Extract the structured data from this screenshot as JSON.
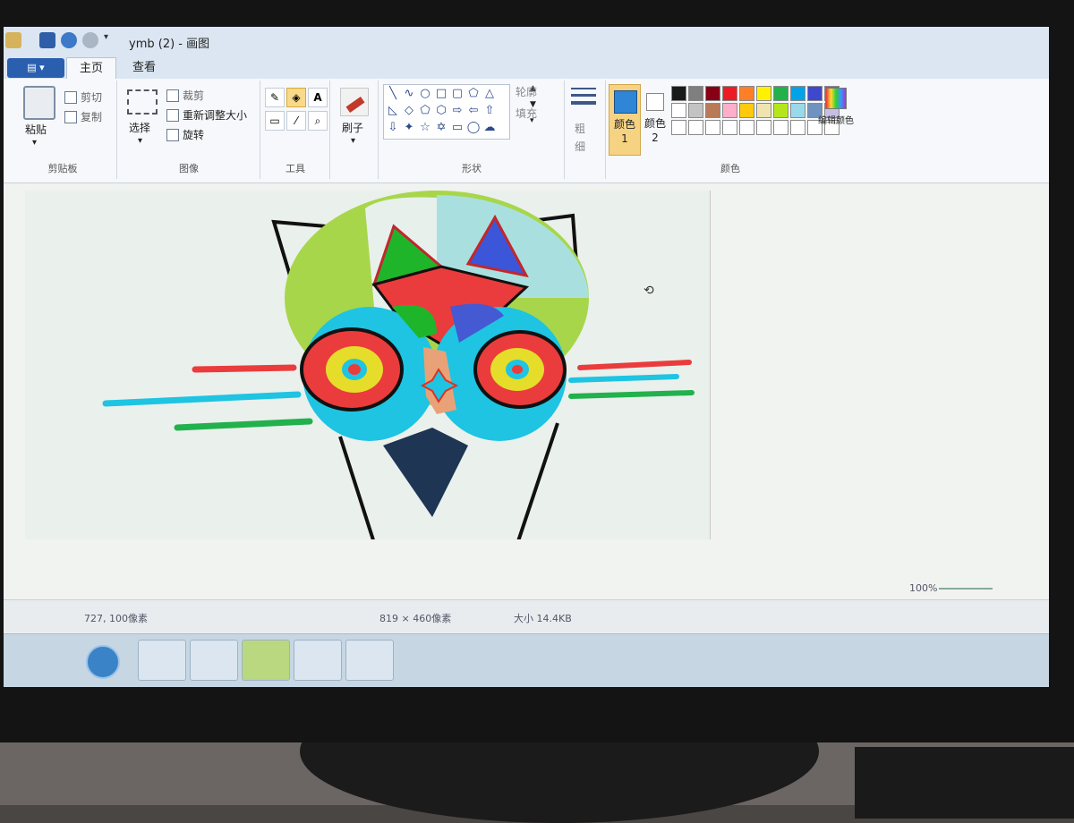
{
  "window": {
    "title": "ymb (2) - 画图"
  },
  "tabs": [
    {
      "label": "主页"
    },
    {
      "label": "查看"
    }
  ],
  "ribbon": {
    "clipboard": {
      "group_label": "剪贴板",
      "paste": "粘贴",
      "cut": "剪切",
      "copy": "复制"
    },
    "image": {
      "group_label": "图像",
      "select": "选择",
      "crop": "裁剪",
      "resize": "重新调整大小",
      "rotate": "旋转"
    },
    "tools": {
      "group_label": "工具"
    },
    "brushes": {
      "label": "刷子"
    },
    "shapes": {
      "group_label": "形状",
      "outline": "轮廓",
      "fill": "填充"
    },
    "size": {
      "label": "粗细"
    },
    "colors": {
      "group_label": "颜色",
      "color1_label": "颜色 1",
      "color2_label": "颜色 2",
      "edit_colors": "编辑颜色",
      "color1_value": "#2f86d6",
      "color2_value": "#ffffff",
      "palette": [
        "#1a1a1a",
        "#7f7f7f",
        "#880015",
        "#ed1c24",
        "#ff7f27",
        "#fff200",
        "#22b14c",
        "#00a2e8",
        "#3f48cc",
        "#a349a4",
        "#ffffff",
        "#c3c3c3",
        "#b97a57",
        "#ffaec9",
        "#ffc90e",
        "#efe4b0",
        "#b5e61d",
        "#99d9ea",
        "#7092be",
        "#c8bfe7",
        "#ffffff",
        "#ffffff",
        "#ffffff",
        "#ffffff",
        "#ffffff",
        "#ffffff",
        "#ffffff",
        "#ffffff",
        "#ffffff",
        "#ffffff"
      ]
    }
  },
  "status": {
    "cursor_pos": "727, 100像素",
    "image_size": "819 × 460像素",
    "file_size": "大小 14.4KB",
    "zoom": "100%"
  }
}
